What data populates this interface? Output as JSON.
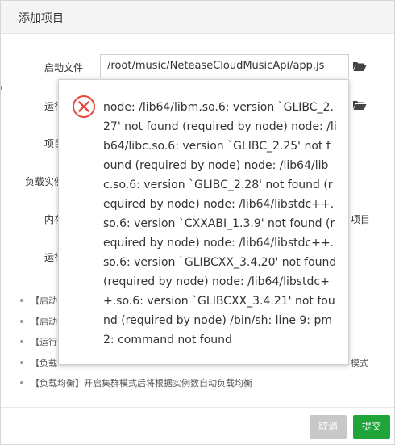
{
  "dialog": {
    "title": "添加项目",
    "fields": {
      "startup_file_label": "启动文件",
      "startup_file_value": "/root/music/NeteaseCloudMusicApi/app.js",
      "run_dir_label": "运行",
      "project_label": "项目",
      "instances_label": "负载实例",
      "memory_label": "内存",
      "run_label": "运行",
      "right_fragment": "项目"
    },
    "notes": [
      "【启动",
      "【启动",
      "【运行",
      "【负载",
      "【负载均衡】开启集群模式后将根据实例数自动负载均衡"
    ],
    "notes_right_fragment": "模式",
    "cancel_label": "取消",
    "submit_label": "提交"
  },
  "error_popup": {
    "message": "node: /lib64/libm.so.6: version `GLIBC_2.27' not found (required by node) node: /lib64/libc.so.6: version `GLIBC_2.25' not found (required by node) node: /lib64/libc.so.6: version `GLIBC_2.28' not found (required by node) node: /lib64/libstdc++.so.6: version `CXXABI_1.3.9' not found (required by node) node: /lib64/libstdc++.so.6: version `GLIBCXX_3.4.20' not found (required by node) node: /lib64/libstdc++.so.6: version `GLIBCXX_3.4.21' not found (required by node) /bin/sh: line 9: pm2: command not found",
    "icon": "error-circle-x-icon"
  },
  "colors": {
    "submit": "#20a53a",
    "cancel": "#c8c8c8",
    "error": "#e8463b",
    "folder": "#444444"
  }
}
